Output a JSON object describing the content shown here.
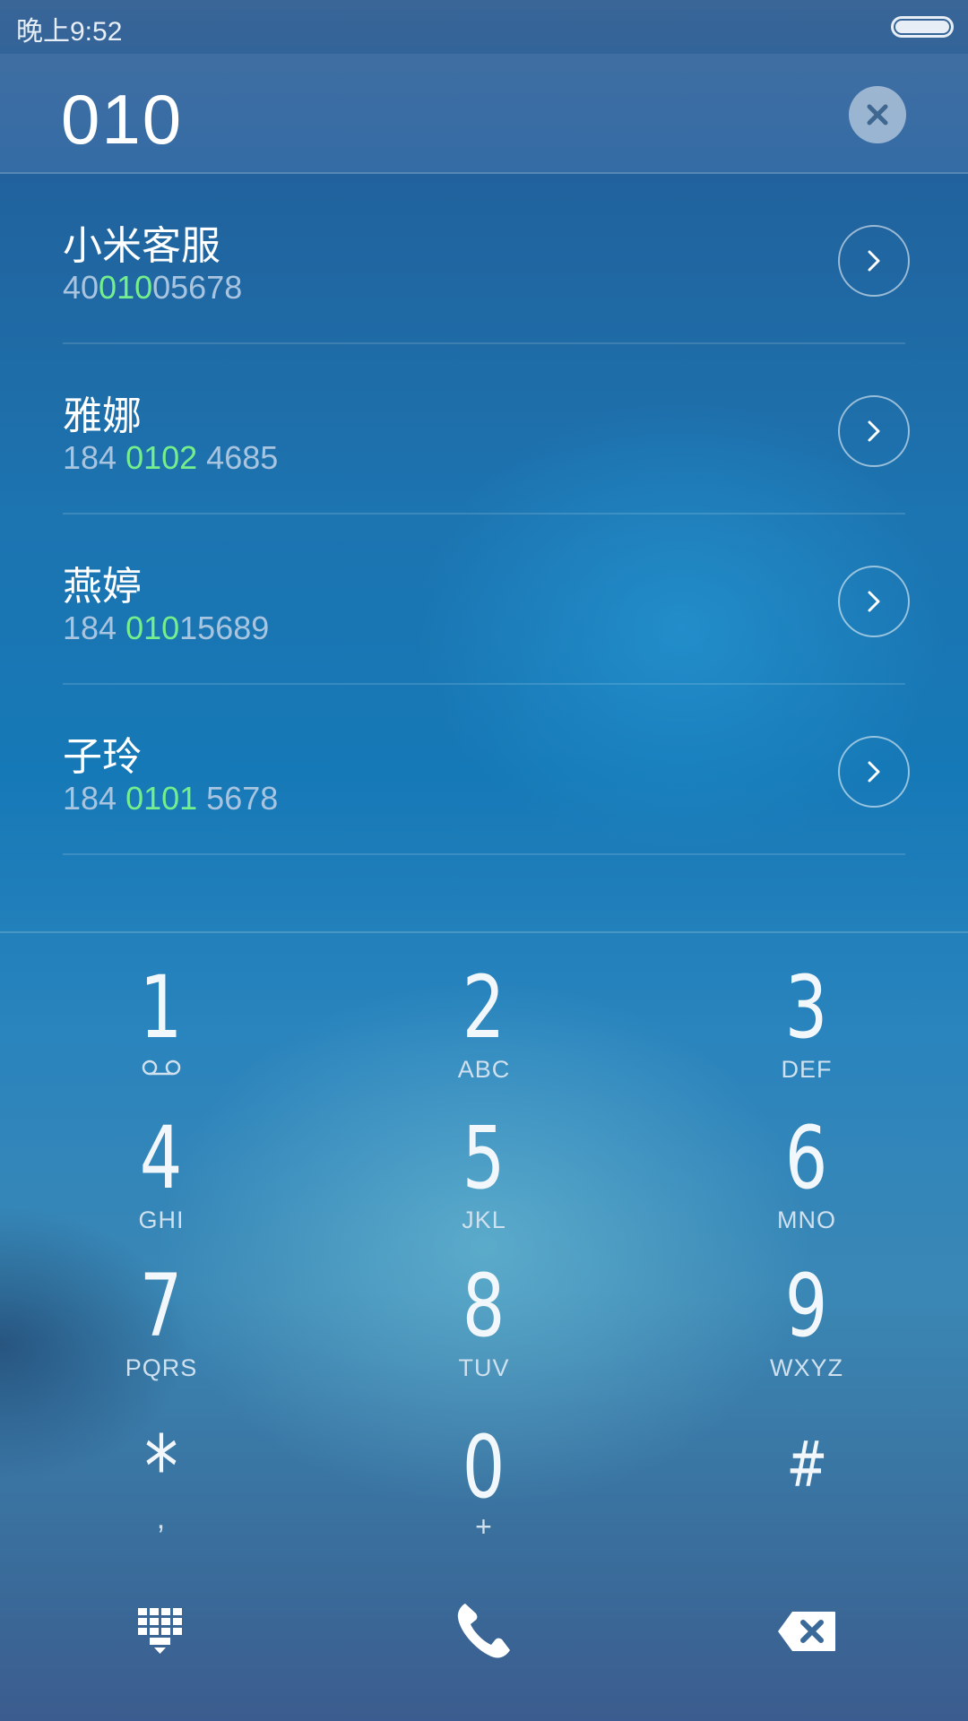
{
  "status_bar": {
    "time": "晚上9:52",
    "battery_level": 1.0
  },
  "dialer": {
    "number": "010",
    "clear_icon": "close-icon"
  },
  "results": [
    {
      "name": "小米客服",
      "number_before": "40",
      "number_match": "010",
      "number_after": "05678"
    },
    {
      "name": "雅娜",
      "number_before": "184 ",
      "number_match": "0102",
      "number_after": " 4685"
    },
    {
      "name": "燕婷",
      "number_before": "184 ",
      "number_match": "010",
      "number_after": "15689"
    },
    {
      "name": "子玲",
      "number_before": "184 ",
      "number_match": "0101",
      "number_after": " 5678"
    }
  ],
  "keypad": {
    "keys": [
      {
        "digit": "1",
        "letters": "",
        "sub_icon": "voicemail-icon"
      },
      {
        "digit": "2",
        "letters": "ABC"
      },
      {
        "digit": "3",
        "letters": "DEF"
      },
      {
        "digit": "4",
        "letters": "GHI"
      },
      {
        "digit": "5",
        "letters": "JKL"
      },
      {
        "digit": "6",
        "letters": "MNO"
      },
      {
        "digit": "7",
        "letters": "PQRS"
      },
      {
        "digit": "8",
        "letters": "TUV"
      },
      {
        "digit": "9",
        "letters": "WXYZ"
      },
      {
        "digit": "*",
        "letters": ","
      },
      {
        "digit": "0",
        "letters": "+"
      },
      {
        "digit": "#",
        "letters": ""
      }
    ]
  },
  "actions": {
    "keypad_toggle_icon": "dialpad-icon",
    "call_icon": "phone-icon",
    "backspace_icon": "backspace-icon"
  },
  "colors": {
    "match_highlight": "#74ef8c",
    "number_text": "#a9c4df"
  }
}
